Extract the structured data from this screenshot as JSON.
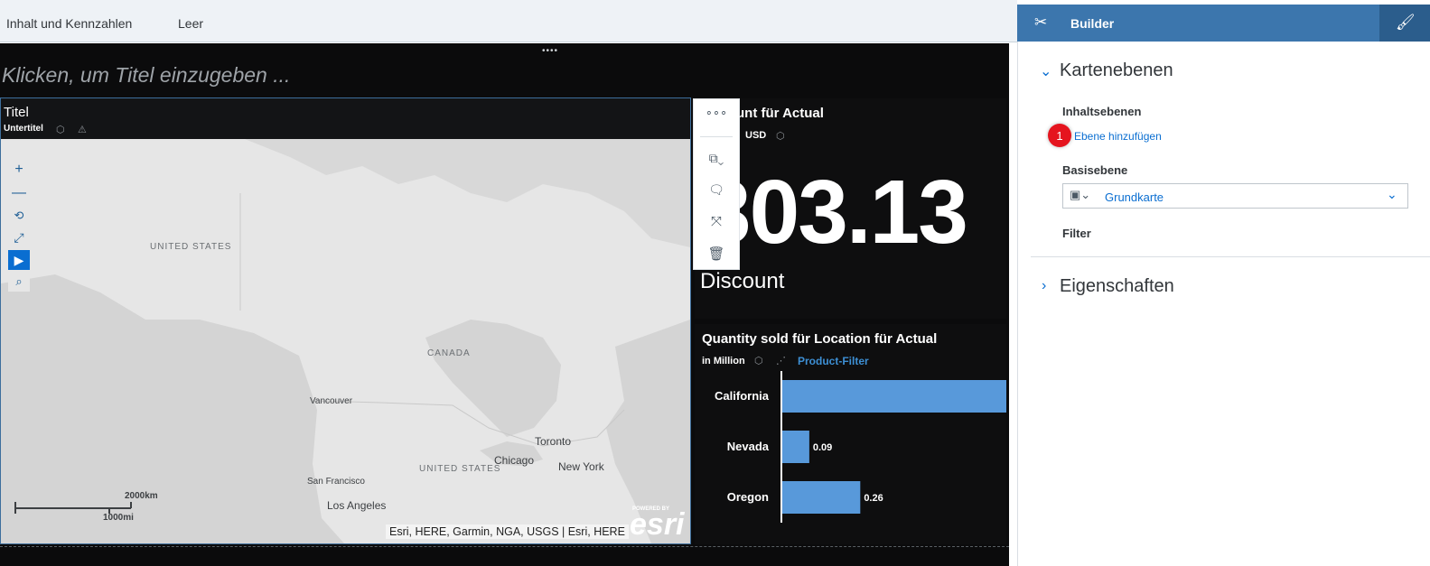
{
  "tabs": [
    "Inhalt und Kennzahlen",
    "Leer"
  ],
  "page": {
    "title_placeholder": "Klicken, um Titel einzugeben ..."
  },
  "map": {
    "title": "Titel",
    "subtitle": "Untertitel",
    "labels": {
      "us_north": "UNITED STATES",
      "canada": "CANADA",
      "us_south": "UNITED STATES"
    },
    "cities": [
      "Vancouver",
      "Toronto",
      "Chicago",
      "New York",
      "San Francisco",
      "Los Angeles"
    ],
    "scale": {
      "km": "2000km",
      "mi": "1000mi"
    },
    "attribution": "Esri, HERE, Garmin, NGA, USGS | Esri, HERE",
    "logo_powered": "POWERED BY",
    "logo": "esri"
  },
  "kpi": {
    "title": "unt für Actual",
    "subtitle": "USD",
    "value": "303.13",
    "label": "Discount"
  },
  "bar": {
    "title": "Quantity sold für Location für Actual",
    "subtitle": "in Million",
    "filter": "Product-Filter"
  },
  "chart_data": {
    "type": "bar",
    "orientation": "horizontal",
    "title": "Quantity sold für Location für Actual",
    "categories": [
      "California",
      "Nevada",
      "Oregon"
    ],
    "values": [
      null,
      0.09,
      0.26
    ],
    "value_labels": [
      "",
      "0.09",
      "0.26"
    ],
    "bar_color": "#5899da"
  },
  "builder": {
    "title": "Builder",
    "sections": {
      "layers": "Kartenebenen",
      "properties": "Eigenschaften"
    },
    "content_layers": "Inhaltsebenen",
    "add_layer": "Ebene hinzufügen",
    "step": "1",
    "basemap_label": "Basisebene",
    "basemap_value": "Grundkarte",
    "filter_label": "Filter"
  },
  "colors": {
    "accent": "#0a6ed1",
    "header": "#3c76ad",
    "canvas": "#0b0b0c",
    "badge": "#e5141e"
  }
}
